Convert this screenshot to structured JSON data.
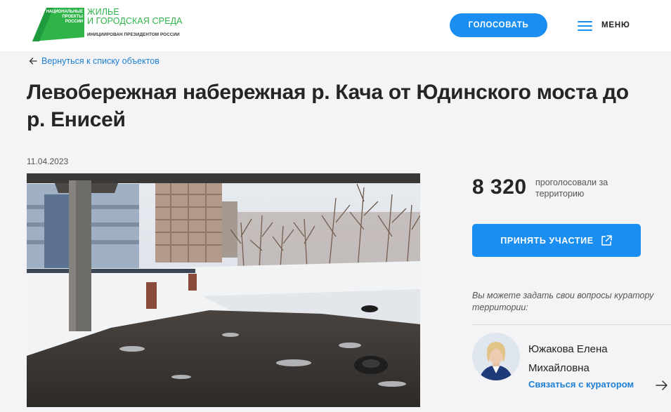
{
  "header": {
    "logo_small": "НАЦИОНАЛЬНЫЕ ПРОЕКТЫ РОССИИ",
    "logo_title_line1": "ЖИЛЬЕ",
    "logo_title_line2": "И ГОРОДСКАЯ СРЕДА",
    "logo_subtitle": "ИНИЦИИРОВАН ПРЕЗИДЕНТОМ РОССИИ",
    "vote_label": "ГОЛОСОВАТЬ",
    "menu_label": "МЕНЮ"
  },
  "page": {
    "back_label": "Вернуться к списку объектов",
    "title": "Левобережная набережная р. Кача от Юдинского моста до р. Енисей",
    "date": "11.04.2023"
  },
  "stats": {
    "votes": "8 320",
    "votes_label": "проголосовали за территорию"
  },
  "participate_label": "ПРИНЯТЬ УЧАСТИЕ",
  "curator": {
    "question": "Вы можете задать свои вопросы куратору территории:",
    "name": "Южакова Елена Михайловна",
    "contact_label": "Связаться с куратором"
  },
  "colors": {
    "accent": "#1b8ff1",
    "link": "#1b7fd6",
    "brand_green": "#2fb44a",
    "background": "#f4f4f6"
  },
  "icons": [
    "hamburger-menu-icon",
    "back-arrow-icon",
    "external-link-icon",
    "arrow-right-icon"
  ]
}
